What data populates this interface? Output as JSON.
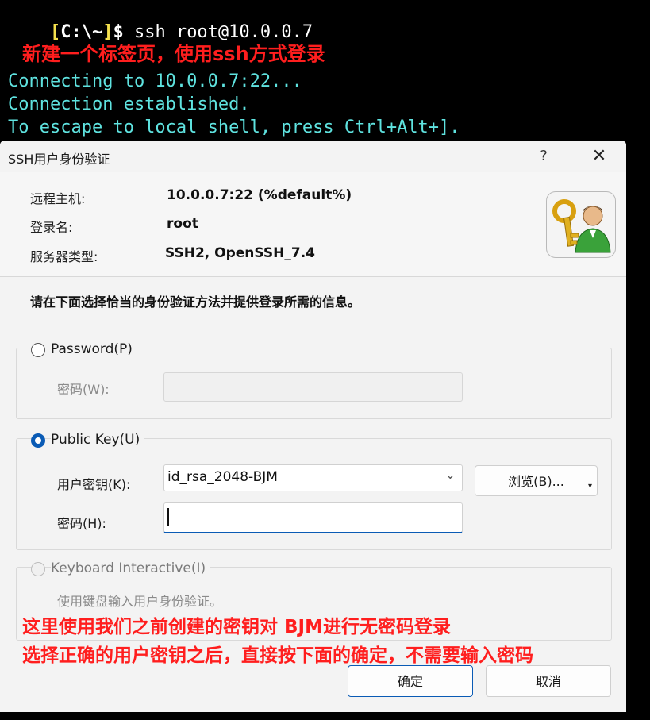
{
  "terminal": {
    "prompt_open": "[",
    "prompt_path": "C:\\~",
    "prompt_close": "]",
    "prompt_dollar": "$",
    "command": " ssh root@10.0.0.7",
    "lines": [
      "Connecting to 10.0.0.7:22...",
      "Connection established.",
      "To escape to local shell, press Ctrl+Alt+]."
    ]
  },
  "annotations": {
    "top": "新建一个标签页，使用ssh方式登录",
    "bottom_line1": "这里使用我们之前创建的密钥对 BJM进行无密码登录",
    "bottom_line2": "选择正确的用户密钥之后，直接按下面的确定，不需要输入密码"
  },
  "dialog": {
    "title": "SSH用户身份验证",
    "help": "?",
    "close": "✕",
    "info": {
      "remote_host_label": "远程主机:",
      "remote_host_value": "10.0.0.7:22 (%default%)",
      "login_label": "登录名:",
      "login_value": "root",
      "server_type_label": "服务器类型:",
      "server_type_value": "SSH2, OpenSSH_7.4"
    },
    "instruction": "请在下面选择恰当的身份验证方法并提供登录所需的信息。",
    "password": {
      "label": "Password(P)",
      "field_label": "密码(W):",
      "value": ""
    },
    "public_key": {
      "label": "Public Key(U)",
      "user_key_label": "用户密钥(K):",
      "user_key_value": "id_rsa_2048-BJM",
      "browse_label": "浏览(B)...",
      "passphrase_label": "密码(H):",
      "passphrase_value": ""
    },
    "keyboard": {
      "label": "Keyboard Interactive(I)",
      "description": "使用键盘输入用户身份验证。"
    },
    "ok_label": "确定",
    "cancel_label": "取消"
  },
  "colors": {
    "terminal_text": "#5fe3e0",
    "annotation": "#ff1e1e",
    "accent": "#0a5bb5"
  }
}
